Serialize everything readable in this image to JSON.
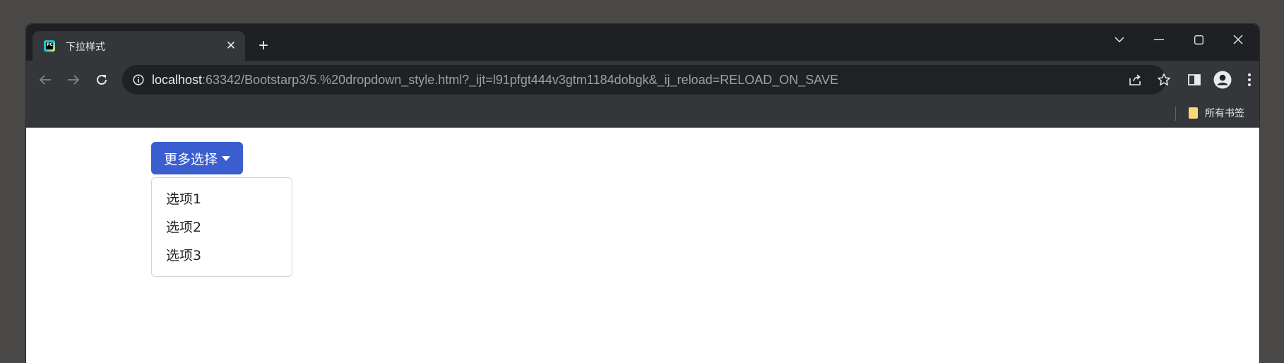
{
  "browser": {
    "tab": {
      "title": "下拉样式",
      "favicon": "pycharm-icon"
    },
    "address_bar": {
      "host": "localhost",
      "rest": ":63342/Bootstarp3/5.%20dropdown_style.html?_ijt=l91pfgt444v3gtm1184dobgk&_ij_reload=RELOAD_ON_SAVE"
    },
    "bookmarks_bar": {
      "all_bookmarks_label": "所有书签"
    }
  },
  "page": {
    "dropdown": {
      "toggle_label": "更多选择",
      "items": [
        {
          "label": "选项1"
        },
        {
          "label": "选项2"
        },
        {
          "label": "选项3"
        }
      ]
    }
  },
  "colors": {
    "button_primary": "#3a5dd0",
    "browser_frame": "#1f2023",
    "toolbar": "#35363a",
    "omnibox": "#202124"
  }
}
